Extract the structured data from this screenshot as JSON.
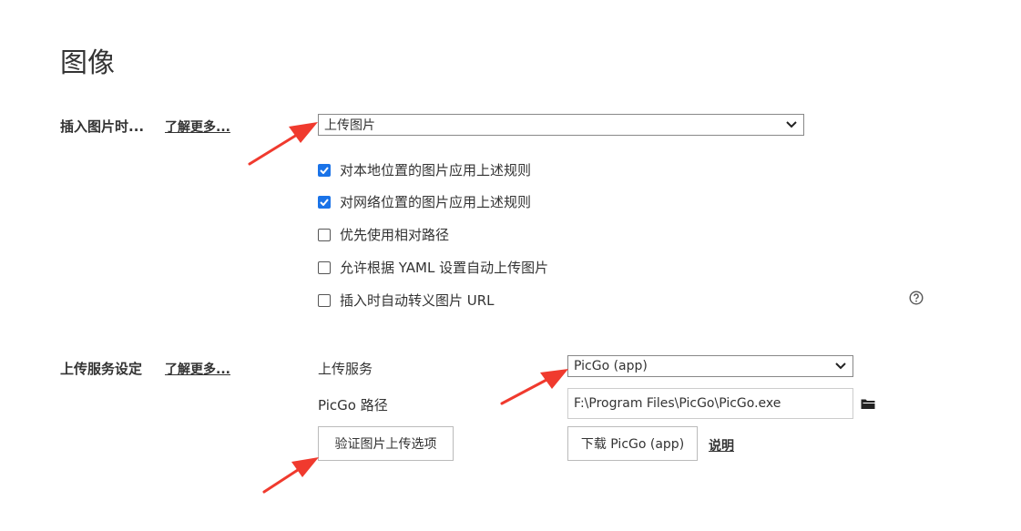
{
  "page": {
    "title": "图像"
  },
  "insert_image": {
    "label": "插入图片时...",
    "learn_more": "了解更多...",
    "select_value": "上传图片",
    "options": [
      {
        "label": "对本地位置的图片应用上述规则",
        "checked": true
      },
      {
        "label": "对网络位置的图片应用上述规则",
        "checked": true
      },
      {
        "label": "优先使用相对路径",
        "checked": false
      },
      {
        "label": "允许根据 YAML 设置自动上传图片",
        "checked": false
      },
      {
        "label": "插入时自动转义图片 URL",
        "checked": false
      }
    ],
    "help_icon": "question-circle-icon"
  },
  "upload_service": {
    "label": "上传服务设定",
    "learn_more": "了解更多...",
    "service_label": "上传服务",
    "service_value": "PicGo (app)",
    "path_label": "PicGo 路径",
    "path_value": "F:\\Program Files\\PicGo\\PicGo.exe",
    "folder_icon": "folder-icon",
    "verify_button": "验证图片上传选项",
    "download_button": "下载 PicGo (app)",
    "explain_link": "说明"
  },
  "colors": {
    "checkbox_checked": "#1a73e8",
    "annotation_arrow": "#f03a2e"
  }
}
